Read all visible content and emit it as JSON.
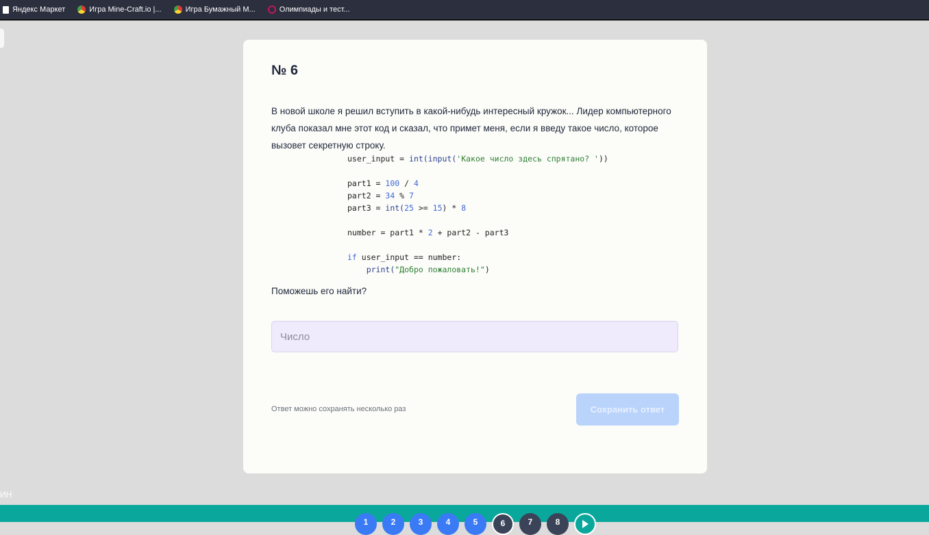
{
  "bookmarks": [
    {
      "label": "Яндекс Маркет",
      "icon": "document-icon"
    },
    {
      "label": "Игра Mine-Craft.io |...",
      "icon": "game-icon"
    },
    {
      "label": "Игра Бумажный М...",
      "icon": "game-icon"
    },
    {
      "label": "Олимпиады и тест...",
      "icon": "globe-icon"
    }
  ],
  "side_text": "ИН",
  "question": {
    "title": "№ 6",
    "text": "В новой школе я решил вступить в какой-нибудь интересный кружок... Лидер компьютерного клуба показал мне этот код и сказал, что примет меня, если я введу такое число, которое вызовет секретную строку.",
    "code": {
      "l1_var": "user_input = ",
      "l1_fn": "int(input(",
      "l1_str": "'Какое число здесь спрятано? '",
      "l1_end": "))",
      "l2_a": "part1 = ",
      "l2_n1": "100",
      "l2_op": " / ",
      "l2_n2": "4",
      "l3_a": "part2 = ",
      "l3_n1": "34",
      "l3_op": " % ",
      "l3_n2": "7",
      "l4_a": "part3 = ",
      "l4_fn": "int(",
      "l4_n1": "25",
      "l4_op": " >= ",
      "l4_n2": "15",
      "l4_b": ") * ",
      "l4_n3": "8",
      "l5_a": "number = part1 * ",
      "l5_n": "2",
      "l5_b": " + part2 - part3",
      "l6_kw": "if",
      "l6_b": " user_input == number:",
      "l7_indent": "    ",
      "l7_fn": "print(",
      "l7_str": "\"Добро пожаловать!\"",
      "l7_end": ")"
    },
    "help_text": "Поможешь его найти?",
    "input_placeholder": "Число",
    "input_value": "",
    "hint": "Ответ можно сохранять несколько раз",
    "save_label": "Сохранить ответ"
  },
  "nav": {
    "items": [
      {
        "label": "1",
        "state": "done"
      },
      {
        "label": "2",
        "state": "done"
      },
      {
        "label": "3",
        "state": "done"
      },
      {
        "label": "4",
        "state": "done"
      },
      {
        "label": "5",
        "state": "done"
      },
      {
        "label": "6",
        "state": "current"
      },
      {
        "label": "7",
        "state": "todo"
      },
      {
        "label": "8",
        "state": "todo"
      }
    ],
    "next_icon": "play-icon"
  },
  "colors": {
    "accent": "#3a7af5",
    "bottom_bar": "#0aa89c",
    "input_bg": "#efeafc",
    "save_disabled": "#b9d3fb"
  }
}
